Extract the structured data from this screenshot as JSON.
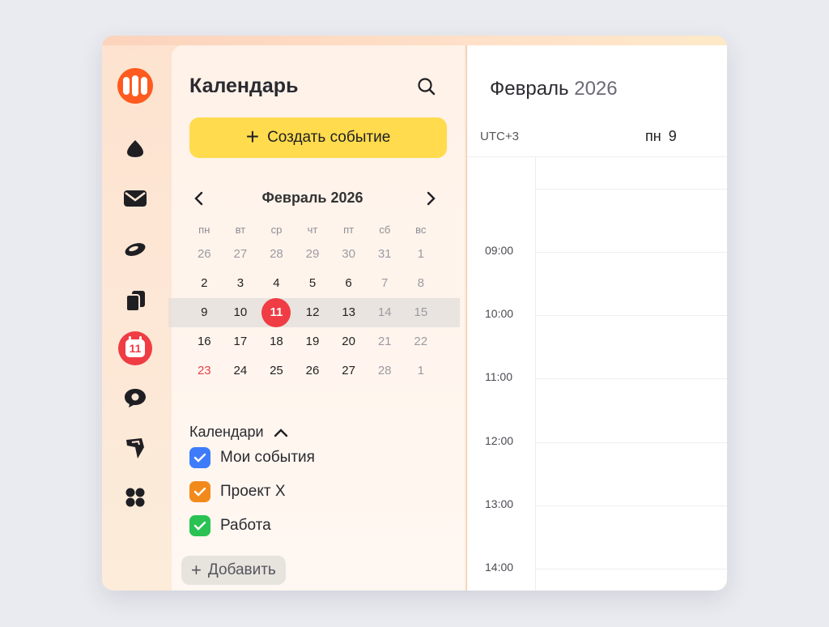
{
  "rail": {
    "icons": [
      "yandex-logo-icon",
      "drop-icon",
      "mail-icon",
      "disk-icon",
      "docs-icon",
      "calendar-icon",
      "messenger-icon",
      "tracker-icon",
      "apps-grid-icon"
    ],
    "calendar_badge": "11"
  },
  "sidebar": {
    "title": "Календарь",
    "create_label": "Создать событие",
    "mini_month": "Февраль 2026",
    "weekdays": [
      "пн",
      "вт",
      "ср",
      "чт",
      "пт",
      "сб",
      "вс"
    ],
    "weeks": [
      [
        "26",
        "27",
        "28",
        "29",
        "30",
        "31",
        "1"
      ],
      [
        "2",
        "3",
        "4",
        "5",
        "6",
        "7",
        "8"
      ],
      [
        "9",
        "10",
        "11",
        "12",
        "13",
        "14",
        "15"
      ],
      [
        "16",
        "17",
        "18",
        "19",
        "20",
        "21",
        "22"
      ],
      [
        "23",
        "24",
        "25",
        "26",
        "27",
        "28",
        "1"
      ]
    ],
    "calendars_label": "Календари",
    "calendars": [
      {
        "label": "Мои события",
        "color": "#3d7bfa"
      },
      {
        "label": "Проект X",
        "color": "#f28a1b"
      },
      {
        "label": "Работа",
        "color": "#29c253"
      }
    ],
    "add_label": "Добавить"
  },
  "main": {
    "month": "Февраль",
    "year": "2026",
    "timezone": "UTC+3",
    "day_name": "пн",
    "day_number": "9",
    "hours": [
      "09:00",
      "10:00",
      "11:00",
      "12:00",
      "13:00",
      "14:00"
    ]
  },
  "colors": {
    "accent": "#ffdb4d",
    "today": "#f03c44",
    "logo": "#ff5a1f"
  }
}
